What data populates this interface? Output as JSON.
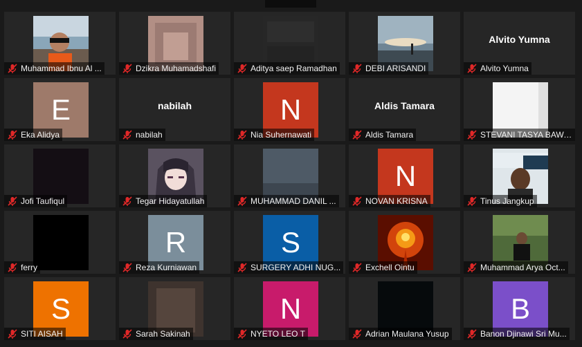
{
  "participants": [
    {
      "name": "Muhammad Ibnu Al ...",
      "avatar_type": "photo",
      "tile_bg": "#8aa6b9"
    },
    {
      "name": "Dzikra Muhamadshafi",
      "avatar_type": "photo",
      "tile_bg": "#9c7b73"
    },
    {
      "name": "Aditya saep Ramadhan",
      "avatar_type": "video",
      "tile_bg": "#262626"
    },
    {
      "name": "DEBI ARISANDI",
      "avatar_type": "photo",
      "tile_bg": "#5c6d78"
    },
    {
      "name": "Alvito Yumna",
      "avatar_type": "text",
      "center_text": "Alvito Yumna"
    },
    {
      "name": "Eka Alidya",
      "avatar_type": "initial",
      "initial": "E",
      "color": "#9e7a6a"
    },
    {
      "name": "nabilah",
      "avatar_type": "text",
      "center_text": "nabilah"
    },
    {
      "name": "Nia Suhernawati",
      "avatar_type": "initial",
      "initial": "N",
      "color": "#c4371e"
    },
    {
      "name": "Aldis Tamara",
      "avatar_type": "text",
      "center_text": "Aldis Tamara"
    },
    {
      "name": "STEVANI TASYA BAWA...",
      "avatar_type": "photo",
      "tile_bg": "#f2f2f2"
    },
    {
      "name": "Jofi Taufiqul",
      "avatar_type": "photo",
      "tile_bg": "#120c12"
    },
    {
      "name": "Tegar Hidayatullah",
      "avatar_type": "photo",
      "tile_bg": "#4a4452"
    },
    {
      "name": "MUHAMMAD DANIL ...",
      "avatar_type": "photo",
      "tile_bg": "#4a5560"
    },
    {
      "name": "NOVAN KRISNA",
      "avatar_type": "initial",
      "initial": "N",
      "color": "#c4371e"
    },
    {
      "name": "Tinus Jangkup",
      "avatar_type": "photo",
      "tile_bg": "#3a5a70"
    },
    {
      "name": "ferry",
      "avatar_type": "photo",
      "tile_bg": "#000000"
    },
    {
      "name": "Reza Kurniawan",
      "avatar_type": "initial",
      "initial": "R",
      "color": "#7b8e9b"
    },
    {
      "name": "SURGERY ADHI NUG...",
      "avatar_type": "initial",
      "initial": "S",
      "color": "#0a5ea6"
    },
    {
      "name": "Exchell Ointu",
      "avatar_type": "photo",
      "tile_bg": "#b02800"
    },
    {
      "name": "Muhammad Arya Oct...",
      "avatar_type": "photo",
      "tile_bg": "#3b4a2c"
    },
    {
      "name": "SITI AISAH",
      "avatar_type": "initial",
      "initial": "S",
      "color": "#ee7200"
    },
    {
      "name": "Sarah Sakinah",
      "avatar_type": "photo",
      "tile_bg": "#4a3c36"
    },
    {
      "name": "NYETO LEO T",
      "avatar_type": "initial",
      "initial": "N",
      "color": "#c81b6b"
    },
    {
      "name": "Adrian Maulana Yusup",
      "avatar_type": "photo",
      "tile_bg": "#060a0c"
    },
    {
      "name": "Banon Djinawi Sri Mu...",
      "avatar_type": "initial",
      "initial": "B",
      "color": "#7b4fc9"
    }
  ],
  "icons": {
    "mic": "mic-muted-icon"
  },
  "colors": {
    "muted_icon": "#e02828",
    "tile_bg": "#262626",
    "app_bg": "#1a1a1a"
  }
}
